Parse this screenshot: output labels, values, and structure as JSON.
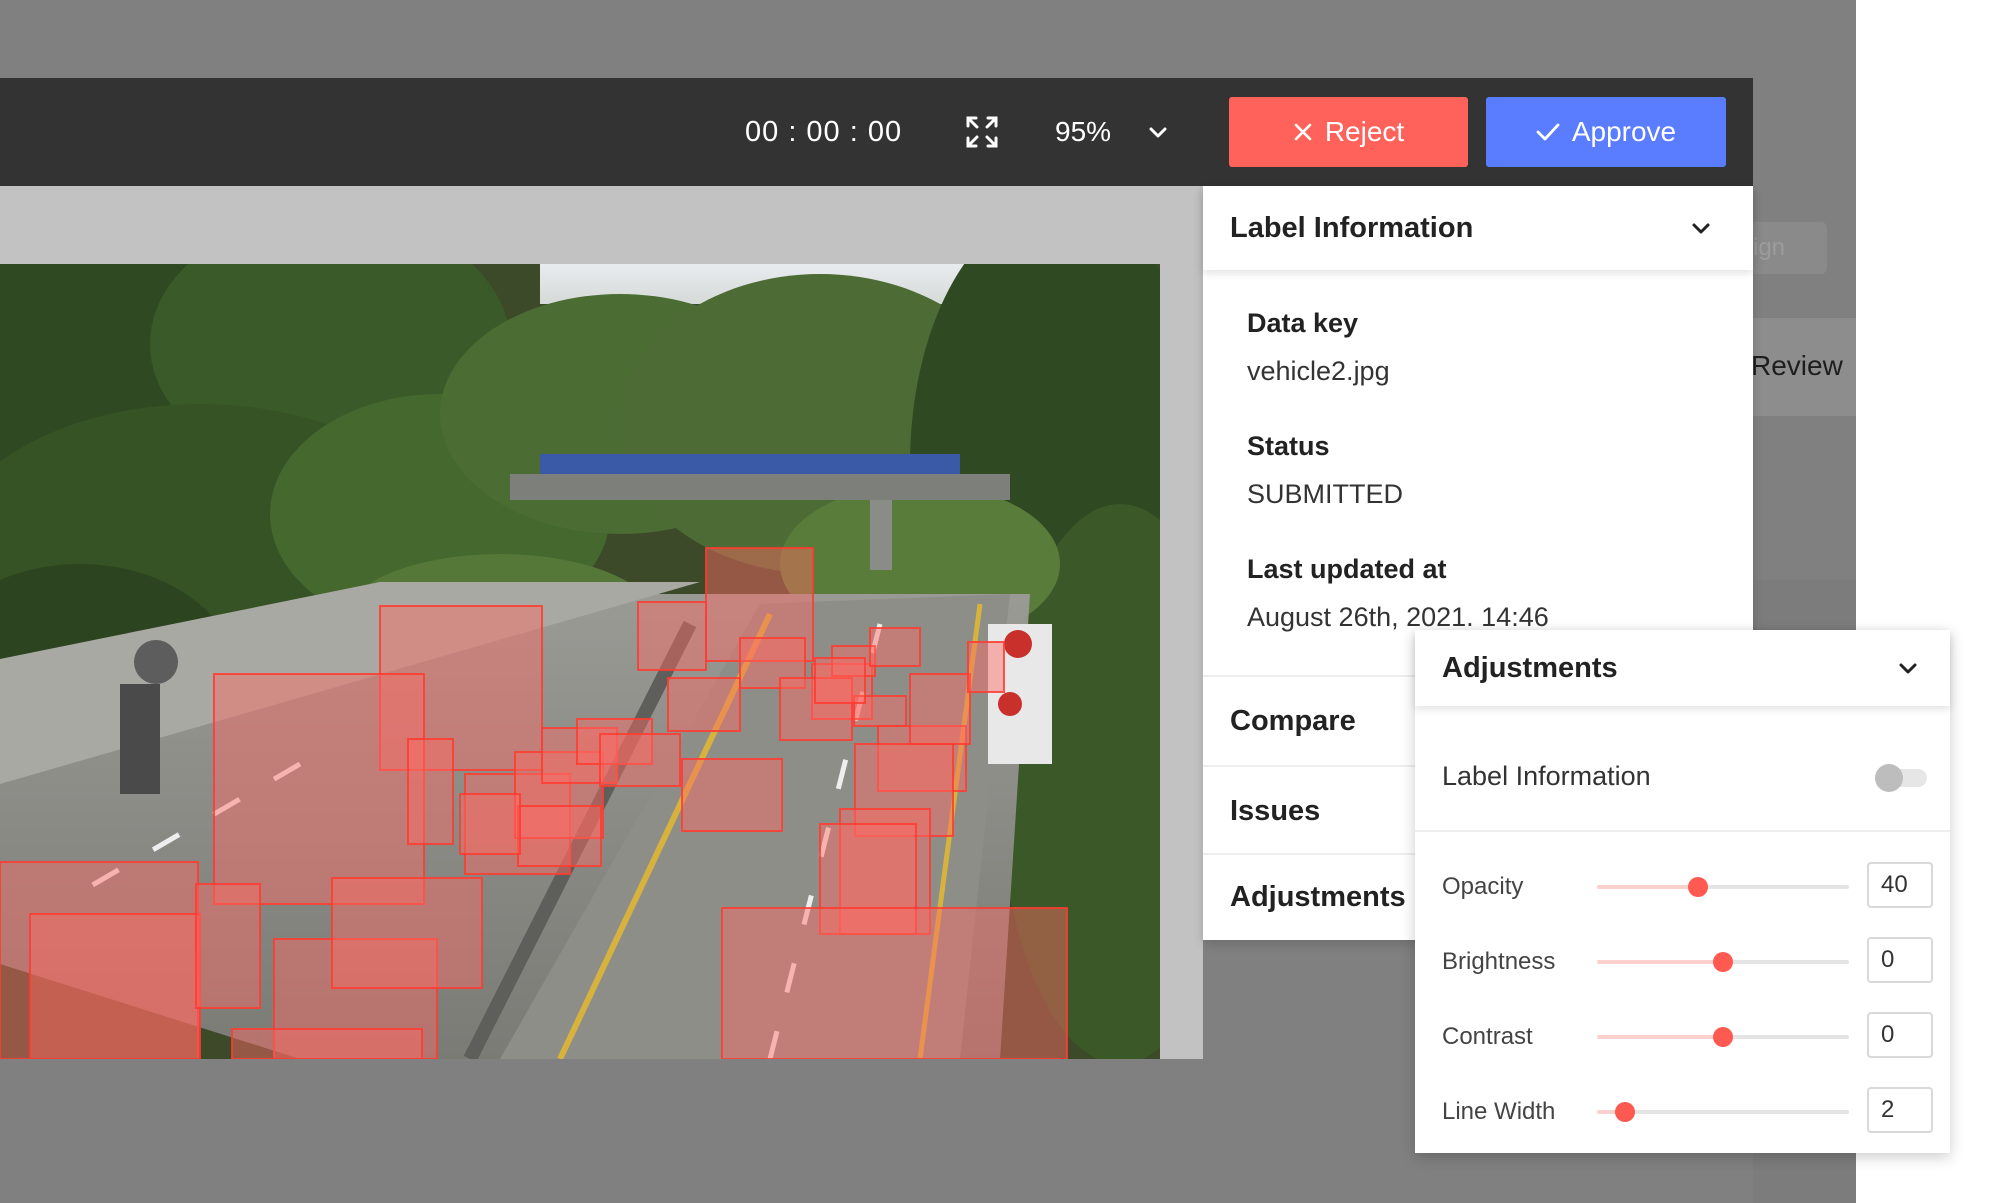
{
  "toolbar": {
    "timer": "00 : 00 : 00",
    "zoom": "95%",
    "reject_label": "Reject",
    "approve_label": "Approve",
    "icons": [
      "expand-icon",
      "chevron-down-icon",
      "close-icon",
      "check-icon"
    ],
    "reject_color": "#ff625a",
    "approve_color": "#5a7dff"
  },
  "background": {
    "assign_label": "sign",
    "review_label": "Review"
  },
  "label_info": {
    "title": "Label Information",
    "fields": [
      {
        "label": "Data key",
        "value": "vehicle2.jpg"
      },
      {
        "label": "Status",
        "value": "SUBMITTED"
      },
      {
        "label": "Last updated at",
        "value": "August 26th, 2021. 14:46"
      }
    ]
  },
  "sections": [
    "Compare",
    "Issues",
    "Adjustments"
  ],
  "adjustments": {
    "title": "Adjustments",
    "toggle_label": "Label Information",
    "toggle_on": false,
    "sliders": [
      {
        "label": "Opacity",
        "value": "40",
        "min": 0,
        "max": 100,
        "level": 40
      },
      {
        "label": "Brightness",
        "value": "0",
        "min": -100,
        "max": 100,
        "level": 0
      },
      {
        "label": "Contrast",
        "value": "0",
        "min": -100,
        "max": 100,
        "level": 0
      },
      {
        "label": "Line Width",
        "value": "2",
        "min": 1,
        "max": 10,
        "level": 2
      }
    ]
  },
  "annotation_color": "#ff5a52"
}
